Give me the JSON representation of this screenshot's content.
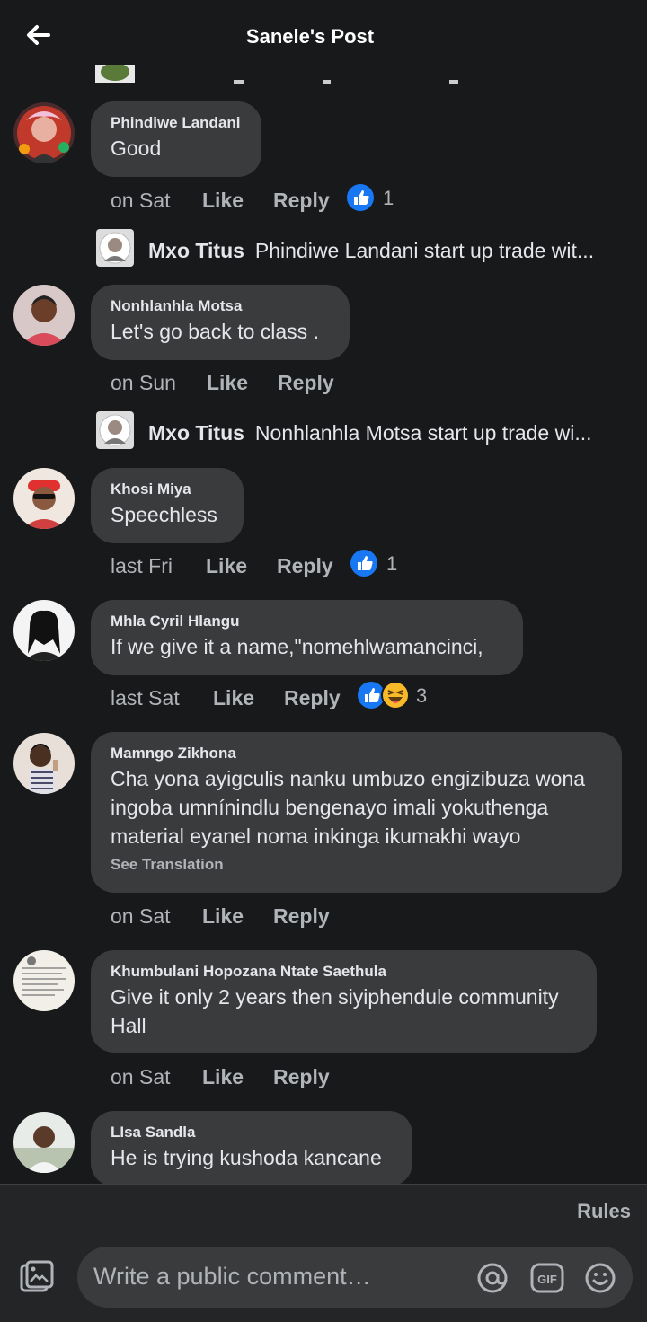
{
  "header": {
    "title": "Sanele's Post"
  },
  "comments": [
    {
      "name": "Phindiwe Landani",
      "text": "Good",
      "time": "on Sat",
      "like": "Like",
      "reply": "Reply",
      "reactions": "1"
    },
    {
      "name": "Nonhlanhla Motsa",
      "text": "Let's go back to class .",
      "time": "on Sun",
      "like": "Like",
      "reply": "Reply"
    },
    {
      "name": "Khosi Miya",
      "text": "Speechless",
      "time": "last Fri",
      "like": "Like",
      "reply": "Reply",
      "reactions": "1"
    },
    {
      "name": "Mhla Cyril Hlangu",
      "text": "If we give it a name,\"nomehlwamancinci,",
      "time": "last Sat",
      "like": "Like",
      "reply": "Reply",
      "reactions": "3"
    },
    {
      "name": "Mamngo Zikhona",
      "text": "Cha yona ayigculis nanku umbuzo engizibuza wona ingoba umnínindlu bengenayo imali yokuthenga material eyanel noma inkinga ikumakhi wayo",
      "see_translation": "See Translation",
      "time": "on Sat",
      "like": "Like",
      "reply": "Reply"
    },
    {
      "name": "Khumbulani Hopozana Ntate Saethula",
      "text": "Give it only 2 years then siyiphendule community Hall",
      "time": "on Sat",
      "like": "Like",
      "reply": "Reply"
    },
    {
      "name": "LIsa Sandla",
      "text": "He is trying kushoda kancane"
    }
  ],
  "replies": [
    {
      "name": "Mxo Titus",
      "text": "Phindiwe Landani start up trade wit..."
    },
    {
      "name": "Mxo Titus",
      "text": "Nonhlanhla Motsa start up trade wi..."
    }
  ],
  "composer": {
    "rules": "Rules",
    "placeholder": "Write a public comment…",
    "gif": "GIF"
  },
  "colors": {
    "background": "#18191a",
    "bubble": "#3a3b3c",
    "text": "#e4e6eb",
    "muted": "#b0b3b8",
    "like_blue": "#1877f2",
    "haha_yellow": "#f7b928"
  },
  "icons": [
    "back-arrow-icon",
    "like-reaction-icon",
    "haha-reaction-icon",
    "photo-icon",
    "mention-icon",
    "gif-icon",
    "emoji-icon"
  ]
}
